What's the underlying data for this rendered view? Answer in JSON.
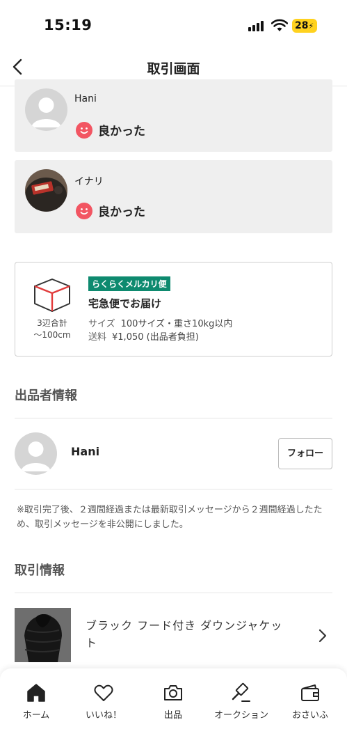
{
  "status_bar": {
    "time": "15:19",
    "battery": "28"
  },
  "nav": {
    "title": "取引画面"
  },
  "reviews": [
    {
      "name": "Hani",
      "rating": "良かった"
    },
    {
      "name": "イナリ",
      "rating": "良かった"
    }
  ],
  "shipping": {
    "badge": "らくらくメルカリ便",
    "method": "宅急便でお届け",
    "size_limit_1": "3辺合計",
    "size_limit_2": "〜100cm",
    "size_label": "サイズ",
    "size_value": "100サイズ・重さ10kg以内",
    "fee_label": "送料",
    "fee_value": "¥1,050 (出品者負担)"
  },
  "seller": {
    "section_title": "出品者情報",
    "name": "Hani",
    "follow_label": "フォロー"
  },
  "notice": "※取引完了後、２週間経過または最新取引メッセージから２週間経過したため、取引メッセージを非公開にしました。",
  "transaction": {
    "section_title": "取引情報",
    "item_name": "ブラック フード付き ダウンジャケット"
  },
  "tabs": [
    {
      "label": "ホーム",
      "icon": "home-icon"
    },
    {
      "label": "いいね！",
      "icon": "heart-icon"
    },
    {
      "label": "出品",
      "icon": "camera-icon"
    },
    {
      "label": "オークション",
      "icon": "gavel-icon"
    },
    {
      "label": "おさいふ",
      "icon": "wallet-icon"
    }
  ],
  "colors": {
    "rating_face": "#f25562",
    "ship_badge": "#0e8a6f",
    "card_bg": "#efefef",
    "battery": "#ffd21f"
  }
}
